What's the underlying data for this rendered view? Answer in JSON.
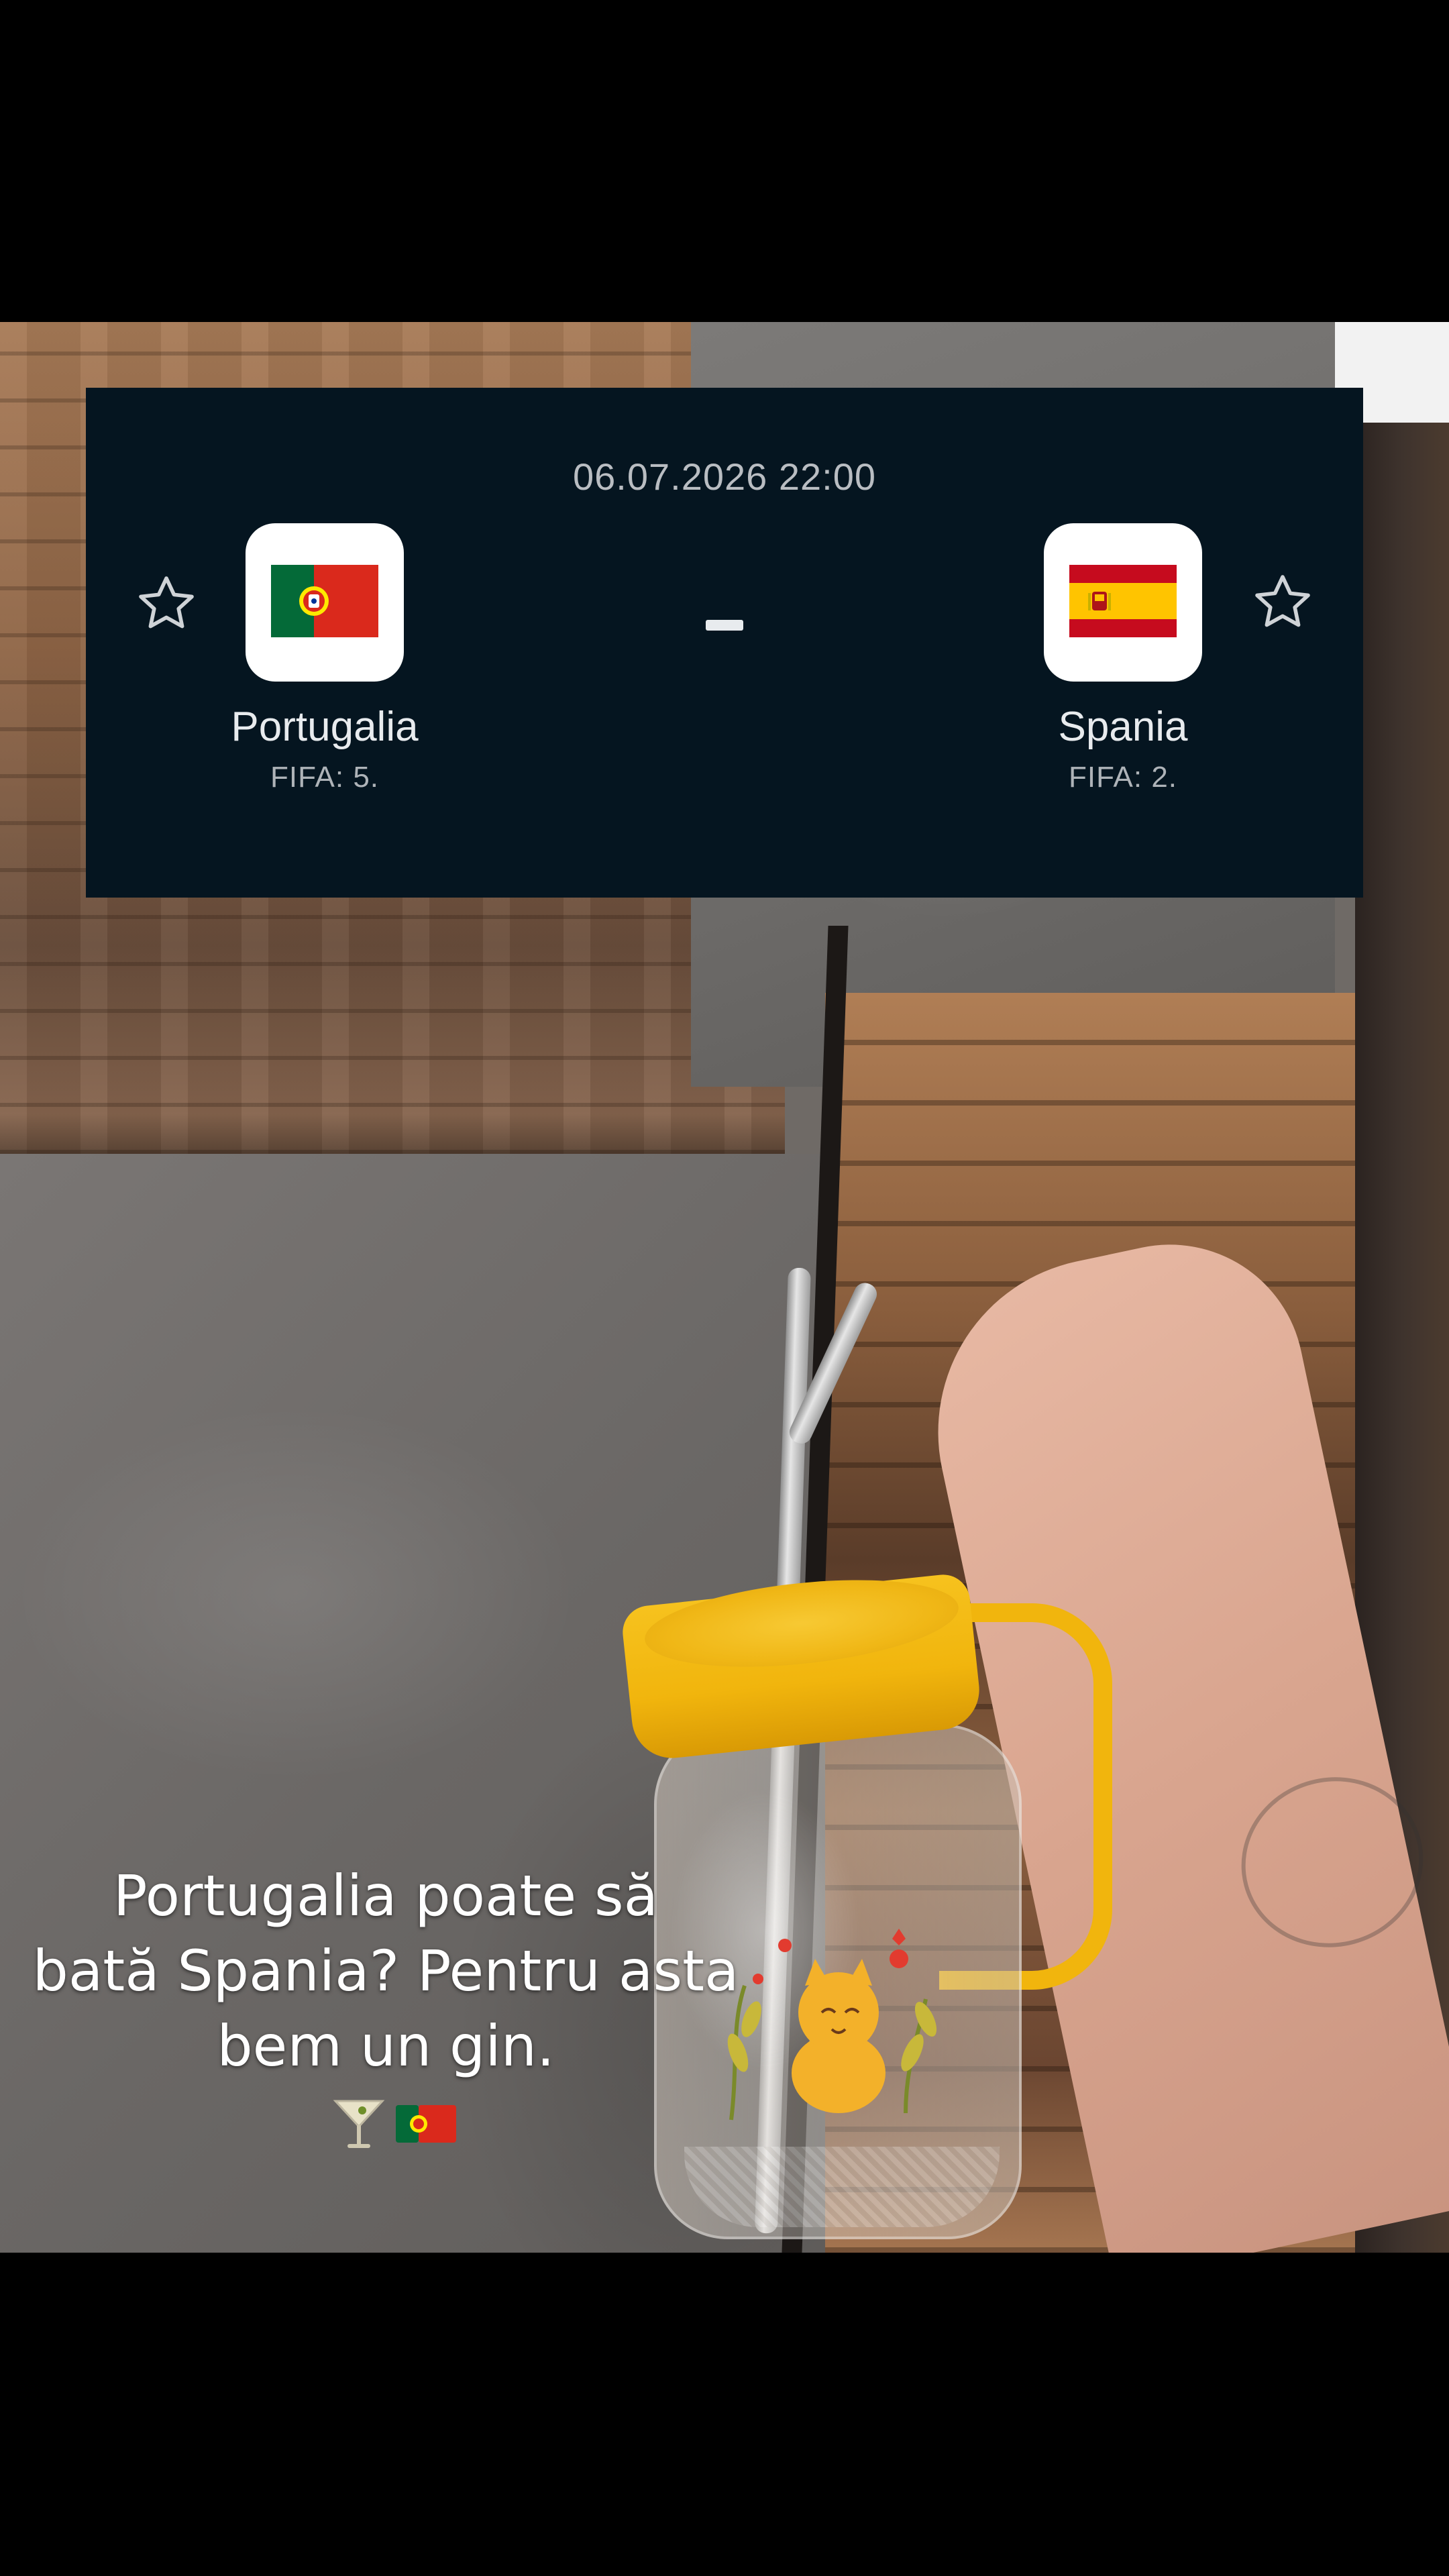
{
  "scorecard": {
    "datetime": "06.07.2026 22:00",
    "score_separator": "-",
    "home": {
      "name": "Portugalia",
      "rank": "FIFA: 5.",
      "flag_icon": "portugal-flag-icon",
      "flag_colors": [
        "#046a38",
        "#da291c",
        "#ffe900"
      ]
    },
    "away": {
      "name": "Spania",
      "rank": "FIFA: 2.",
      "flag_icon": "spain-flag-icon",
      "flag_colors": [
        "#c60b1e",
        "#ffc400"
      ]
    },
    "favorite_icon": "star-outline-icon",
    "background_color": "#051520"
  },
  "caption": {
    "lines": [
      "Portugalia poate să",
      "bată Spania? Pentru asta",
      "bem un gin."
    ],
    "emojis": [
      "cocktail-glass-icon",
      "portugal-flag-icon"
    ]
  }
}
